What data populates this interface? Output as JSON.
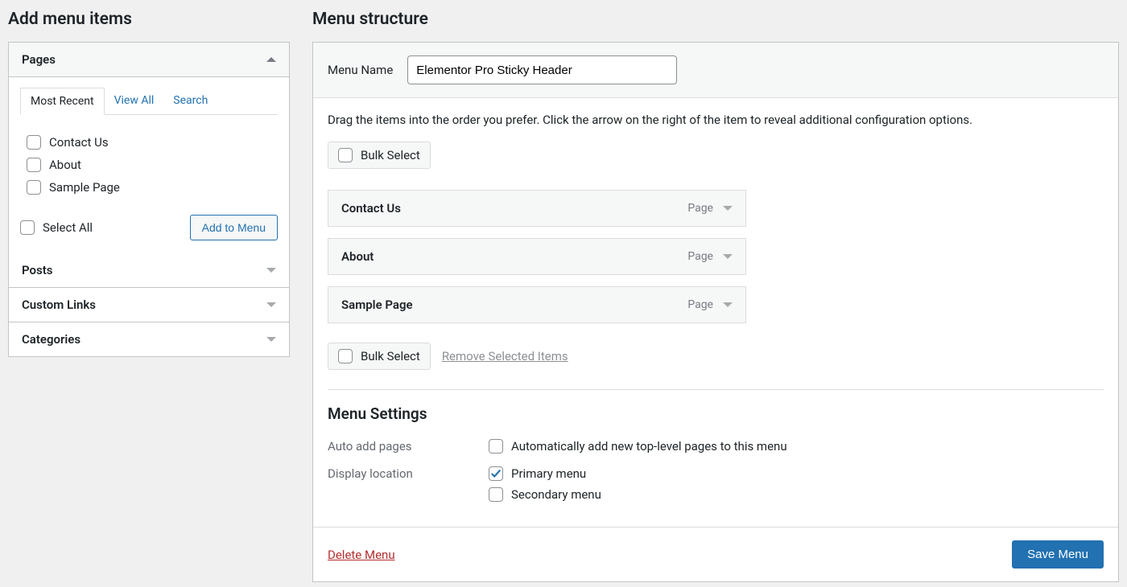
{
  "left": {
    "title": "Add menu items",
    "pages_box": {
      "title": "Pages",
      "expanded": true,
      "tabs": {
        "recent": "Most Recent",
        "view_all": "View All",
        "search": "Search"
      },
      "items": [
        {
          "label": "Contact Us"
        },
        {
          "label": "About"
        },
        {
          "label": "Sample Page"
        }
      ],
      "select_all": "Select All",
      "add_button": "Add to Menu"
    },
    "other_boxes": [
      {
        "title": "Posts"
      },
      {
        "title": "Custom Links"
      },
      {
        "title": "Categories"
      }
    ]
  },
  "right": {
    "title": "Menu structure",
    "menu_name_label": "Menu Name",
    "menu_name_value": "Elementor Pro Sticky Header",
    "help": "Drag the items into the order you prefer. Click the arrow on the right of the item to reveal additional configuration options.",
    "bulk_label": "Bulk Select",
    "remove_label": "Remove Selected Items",
    "type_label": "Page",
    "items": [
      {
        "title": "Contact Us"
      },
      {
        "title": "About"
      },
      {
        "title": "Sample Page"
      }
    ],
    "settings": {
      "title": "Menu Settings",
      "auto_add_label": "Auto add pages",
      "auto_add_option": "Automatically add new top-level pages to this menu",
      "display_label": "Display location",
      "display_options": [
        {
          "label": "Primary menu",
          "checked": true
        },
        {
          "label": "Secondary menu",
          "checked": false
        }
      ]
    },
    "delete": "Delete Menu",
    "save": "Save Menu"
  }
}
